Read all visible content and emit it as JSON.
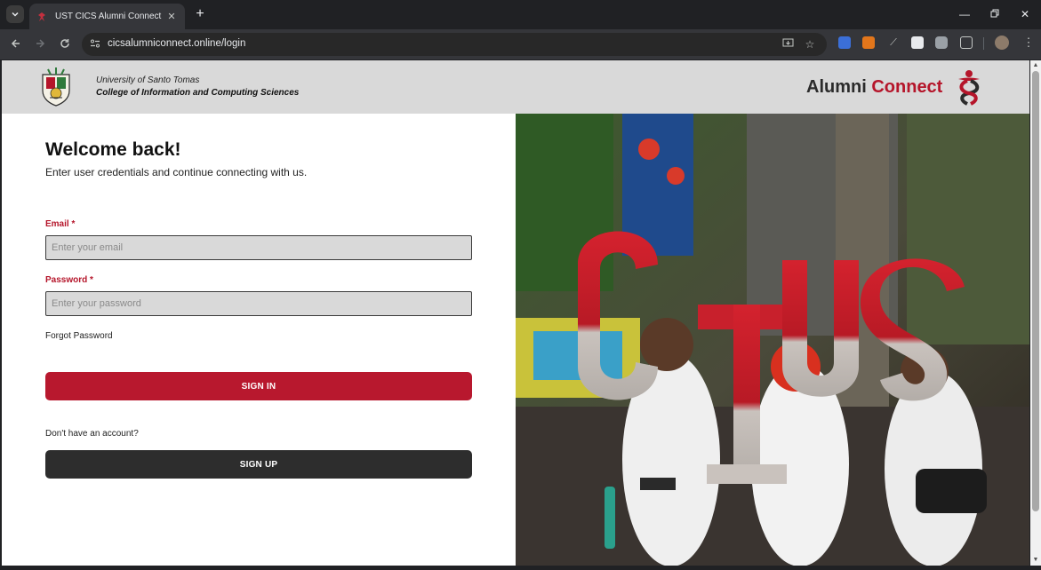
{
  "browser": {
    "tab_title": "UST CICS Alumni Connect",
    "url": "cicsalumniconnect.online/login",
    "new_tab_label": "+",
    "tab_close_label": "✕"
  },
  "header": {
    "university": "University of Santo Tomas",
    "college": "College of Information and Computing Sciences",
    "brand_part1": "Alumni",
    "brand_part2": "Connect"
  },
  "login": {
    "heading": "Welcome back!",
    "subheading": "Enter user credentials and continue connecting with us.",
    "email_label": "Email *",
    "email_placeholder": "Enter your email",
    "email_value": "",
    "password_label": "Password *",
    "password_placeholder": "Enter your password",
    "password_value": "",
    "forgot_label": "Forgot Password",
    "signin_label": "SIGN IN",
    "no_account_text": "Don't have an account?",
    "signup_label": "SIGN UP"
  },
  "colors": {
    "accent": "#b8182e",
    "header_bg": "#d9d9d9",
    "dark_button": "#2d2d2d"
  }
}
